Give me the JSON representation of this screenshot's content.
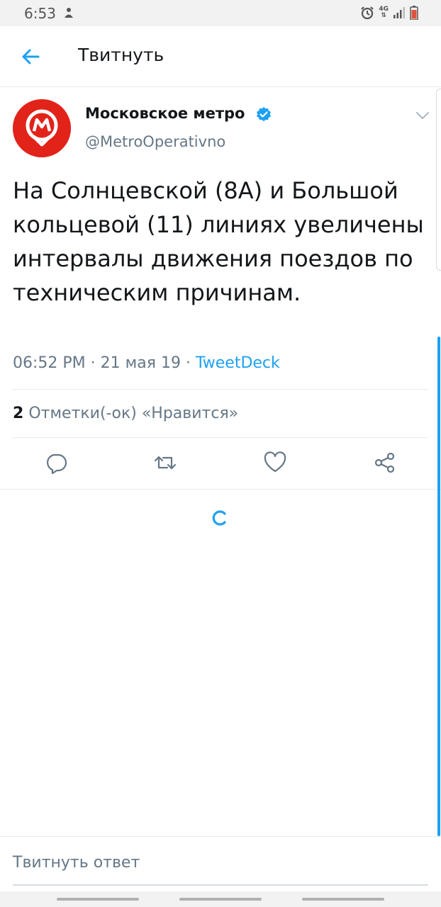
{
  "status_bar": {
    "time": "6:53",
    "network": "4G"
  },
  "header": {
    "title": "Твитнуть"
  },
  "tweet": {
    "author_name": "Московское метро",
    "author_handle": "@MetroOperativno",
    "text": "На Солнцевской (8А) и Большой кольцевой (11) линиях увеличены интервалы движения поездов по техническим причинам.",
    "time": "06:52 PM",
    "date": "21 мая 19",
    "source": "TweetDeck",
    "likes_count": "2",
    "likes_label": "Отметки(-ок) «Нравится»"
  },
  "reply": {
    "placeholder": "Твитнуть ответ"
  },
  "colors": {
    "accent": "#1da1f2",
    "metro_red": "#e2231a",
    "text_secondary": "#657786"
  },
  "icons": [
    "back-arrow-icon",
    "verified-icon",
    "chevron-down-icon",
    "reply-icon",
    "retweet-icon",
    "like-icon",
    "share-icon",
    "loading-spinner-icon"
  ]
}
